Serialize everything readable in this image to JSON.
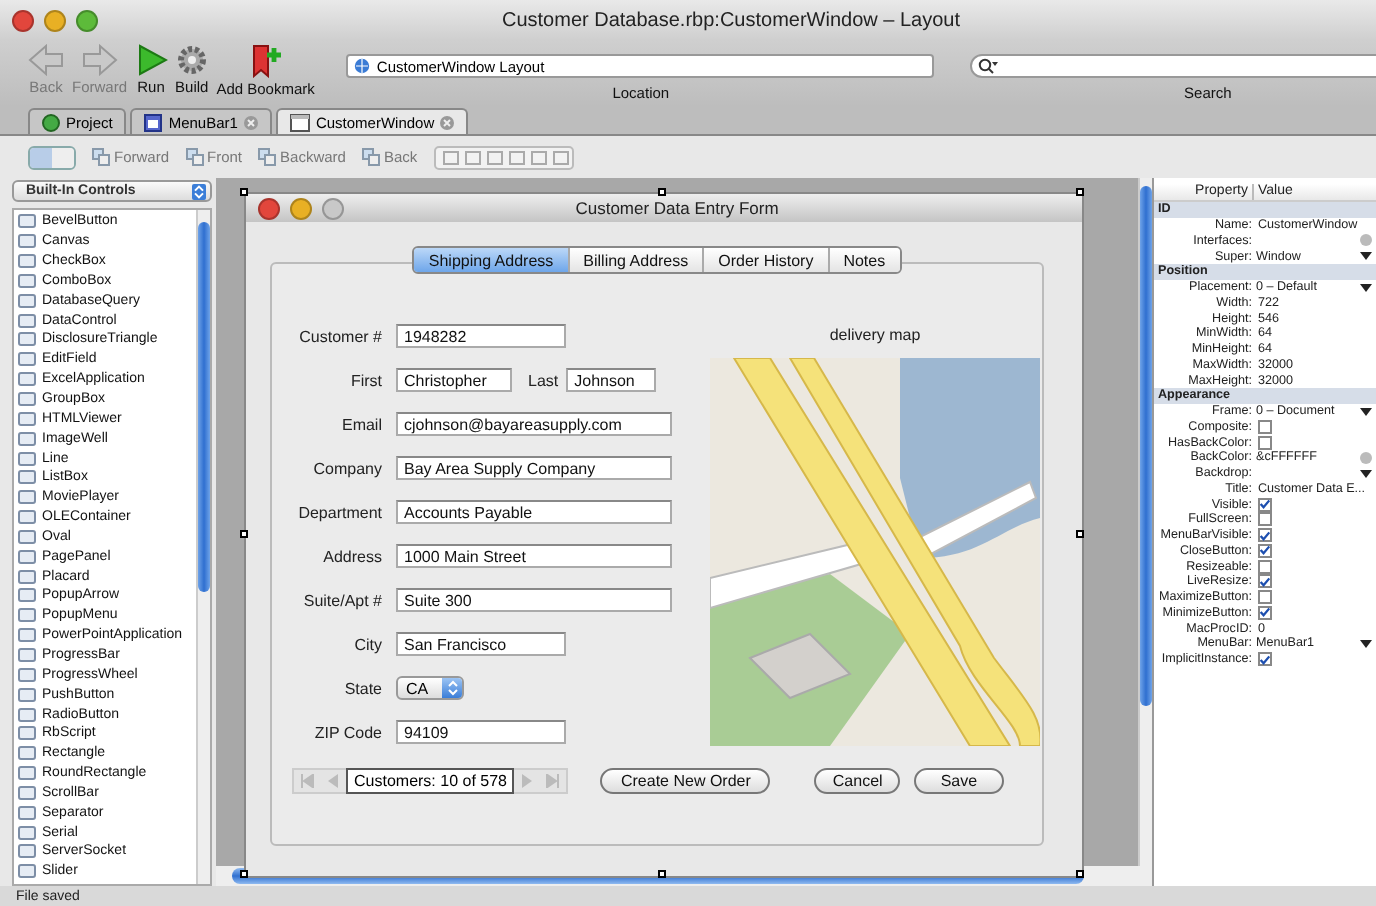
{
  "window": {
    "title": "Customer Database.rbp:CustomerWindow – Layout"
  },
  "toolbar": {
    "buttons": [
      {
        "kind": "back",
        "label": "Back",
        "disabled": true
      },
      {
        "kind": "forward",
        "label": "Forward",
        "disabled": true
      },
      {
        "kind": "run",
        "label": "Run",
        "disabled": false
      },
      {
        "kind": "build",
        "label": "Build",
        "disabled": false
      },
      {
        "kind": "bookmark",
        "label": "Add Bookmark",
        "disabled": false
      }
    ],
    "location": {
      "value": "CustomerWindow Layout",
      "label": "Location"
    },
    "search": {
      "label": "Search"
    }
  },
  "doc_tabs": [
    {
      "kind": "project",
      "label": "Project",
      "selected": false,
      "closable": false
    },
    {
      "kind": "menubar",
      "label": "MenuBar1",
      "selected": false,
      "closable": true
    },
    {
      "kind": "window",
      "label": "CustomerWindow",
      "selected": true,
      "closable": true
    }
  ],
  "view_modes": [
    {
      "selected": true
    },
    {
      "selected": false
    }
  ],
  "editor_toolbar": [
    "Forward",
    "Front",
    "Backward",
    "Back"
  ],
  "controls_panel": {
    "dropdown": "Built-In Controls",
    "items": [
      "BevelButton",
      "Canvas",
      "CheckBox",
      "ComboBox",
      "DatabaseQuery",
      "DataControl",
      "DisclosureTriangle",
      "EditField",
      "ExcelApplication",
      "GroupBox",
      "HTMLViewer",
      "ImageWell",
      "Line",
      "ListBox",
      "MoviePlayer",
      "OLEContainer",
      "Oval",
      "PagePanel",
      "Placard",
      "PopupArrow",
      "PopupMenu",
      "PowerPointApplication",
      "ProgressBar",
      "ProgressWheel",
      "PushButton",
      "RadioButton",
      "RbScript",
      "Rectangle",
      "RoundRectangle",
      "ScrollBar",
      "Separator",
      "Serial",
      "ServerSocket",
      "Slider"
    ]
  },
  "form": {
    "title": "Customer Data Entry Form",
    "tabs": [
      {
        "label": "Shipping Address",
        "selected": true
      },
      {
        "label": "Billing Address",
        "selected": false
      },
      {
        "label": "Order History",
        "selected": false
      },
      {
        "label": "Notes",
        "selected": false
      }
    ],
    "rows": [
      {
        "fields": [
          {
            "label": "Customer #",
            "value": "1948282",
            "kind": "short"
          }
        ]
      },
      {
        "fields": [
          {
            "label": "First",
            "value": "Christopher",
            "kind": "first"
          },
          {
            "label": "Last",
            "value": "Johnson",
            "kind": "last"
          }
        ]
      },
      {
        "fields": [
          {
            "label": "Email",
            "value": "cjohnson@bayareasupply.com",
            "kind": "long"
          }
        ]
      },
      {
        "fields": [
          {
            "label": "Company",
            "value": "Bay Area Supply Company",
            "kind": "long"
          }
        ]
      },
      {
        "fields": [
          {
            "label": "Department",
            "value": "Accounts Payable",
            "kind": "long"
          }
        ]
      },
      {
        "fields": [
          {
            "label": "Address",
            "value": "1000 Main Street",
            "kind": "long"
          }
        ]
      },
      {
        "fields": [
          {
            "label": "Suite/Apt #",
            "value": "Suite 300",
            "kind": "long"
          }
        ]
      },
      {
        "fields": [
          {
            "label": "City",
            "value": "San Francisco",
            "kind": "short"
          }
        ]
      },
      {
        "fields": [
          {
            "label": "State",
            "value": "CA",
            "kind": "popup"
          }
        ]
      },
      {
        "fields": [
          {
            "label": "ZIP Code",
            "value": "94109",
            "kind": "short"
          }
        ]
      }
    ],
    "map_caption": "delivery map",
    "navigator": "Customers: 10 of 578",
    "buttons": [
      "Create New Order",
      "Cancel",
      "Save"
    ]
  },
  "properties": {
    "columns": [
      "Property",
      "Value"
    ],
    "rows": [
      {
        "kind": "group",
        "name": "ID"
      },
      {
        "kind": "text",
        "name": "Name:",
        "value": "CustomerWindow"
      },
      {
        "kind": "picker",
        "name": "Interfaces:",
        "value": ""
      },
      {
        "kind": "popup",
        "name": "Super:",
        "value": "Window"
      },
      {
        "kind": "group",
        "name": "Position"
      },
      {
        "kind": "popup",
        "name": "Placement:",
        "value": "0 – Default"
      },
      {
        "kind": "text",
        "name": "Width:",
        "value": "722"
      },
      {
        "kind": "text",
        "name": "Height:",
        "value": "546"
      },
      {
        "kind": "text",
        "name": "MinWidth:",
        "value": "64"
      },
      {
        "kind": "text",
        "name": "MinHeight:",
        "value": "64"
      },
      {
        "kind": "text",
        "name": "MaxWidth:",
        "value": "32000"
      },
      {
        "kind": "text",
        "name": "MaxHeight:",
        "value": "32000"
      },
      {
        "kind": "group",
        "name": "Appearance"
      },
      {
        "kind": "popup",
        "name": "Frame:",
        "value": "0 – Document"
      },
      {
        "kind": "check",
        "name": "Composite:",
        "checked": false
      },
      {
        "kind": "check",
        "name": "HasBackColor:",
        "checked": false
      },
      {
        "kind": "picker",
        "name": "BackColor:",
        "value": "&cFFFFFF"
      },
      {
        "kind": "popup",
        "name": "Backdrop:",
        "value": ""
      },
      {
        "kind": "text",
        "name": "Title:",
        "value": "Customer Data E..."
      },
      {
        "kind": "check",
        "name": "Visible:",
        "checked": true
      },
      {
        "kind": "check",
        "name": "FullScreen:",
        "checked": false
      },
      {
        "kind": "check",
        "name": "MenuBarVisible:",
        "checked": true
      },
      {
        "kind": "check",
        "name": "CloseButton:",
        "checked": true
      },
      {
        "kind": "check",
        "name": "Resizeable:",
        "checked": false
      },
      {
        "kind": "check",
        "name": "LiveResize:",
        "checked": true
      },
      {
        "kind": "check",
        "name": "MaximizeButton:",
        "checked": false
      },
      {
        "kind": "check",
        "name": "MinimizeButton:",
        "checked": true
      },
      {
        "kind": "text",
        "name": "MacProcID:",
        "value": "0"
      },
      {
        "kind": "popup",
        "name": "MenuBar:",
        "value": "MenuBar1"
      },
      {
        "kind": "check",
        "name": "ImplicitInstance:",
        "checked": true
      }
    ]
  },
  "status_bar": "File saved"
}
